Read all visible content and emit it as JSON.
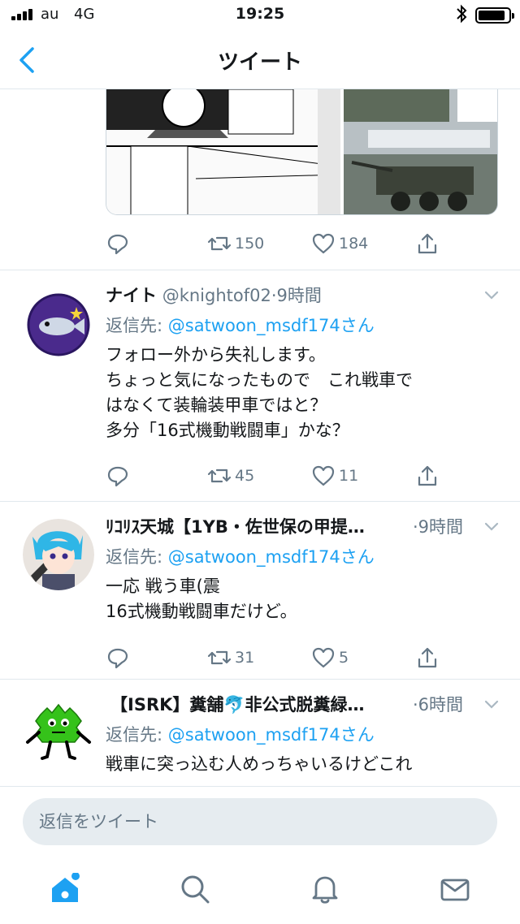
{
  "status_bar": {
    "carrier": "au",
    "network": "4G",
    "time": "19:25"
  },
  "nav": {
    "title": "ツイート",
    "back_icon": "chevron-left-icon"
  },
  "prev_tweet": {
    "retweets": "150",
    "likes": "184"
  },
  "tweets": [
    {
      "name": "ナイト",
      "handle": "@knightof02",
      "time": "·9時間",
      "reply_label": "返信先: ",
      "reply_to": "@satwoon_msdf174さん",
      "text": "フォロー外から失礼します。\nちょっと気になったもので　これ戦車で\nはなくて装輪装甲車ではと？\n多分「16式機動戦闘車」かな？",
      "retweets": "45",
      "likes": "11"
    },
    {
      "name": "ﾘｺﾘｽ天城【1YB・佐世保の甲提…",
      "handle": "",
      "time": "·9時間",
      "reply_label": "返信先: ",
      "reply_to": "@satwoon_msdf174さん",
      "text": "一応 戦う車(震\n16式機動戦闘車だけど。",
      "retweets": "31",
      "likes": "5"
    },
    {
      "name": "【ISRK】糞舗🐬非公式脱糞緑…",
      "handle": "",
      "time": "·6時間",
      "reply_label": "返信先: ",
      "reply_to": "@satwoon_msdf174さん",
      "text": "戦車に突っ込む人めっちゃいるけどこれ",
      "retweets": "",
      "likes": ""
    }
  ],
  "compose": {
    "placeholder": "返信をツイート"
  },
  "tab_bar": {
    "items": [
      "home-icon",
      "search-icon",
      "notifications-icon",
      "messages-icon"
    ]
  },
  "colors": {
    "accent": "#1da1f2",
    "secondary_text": "#657786",
    "divider": "#e1e8ed",
    "compose_bg": "#e6ecf0"
  }
}
